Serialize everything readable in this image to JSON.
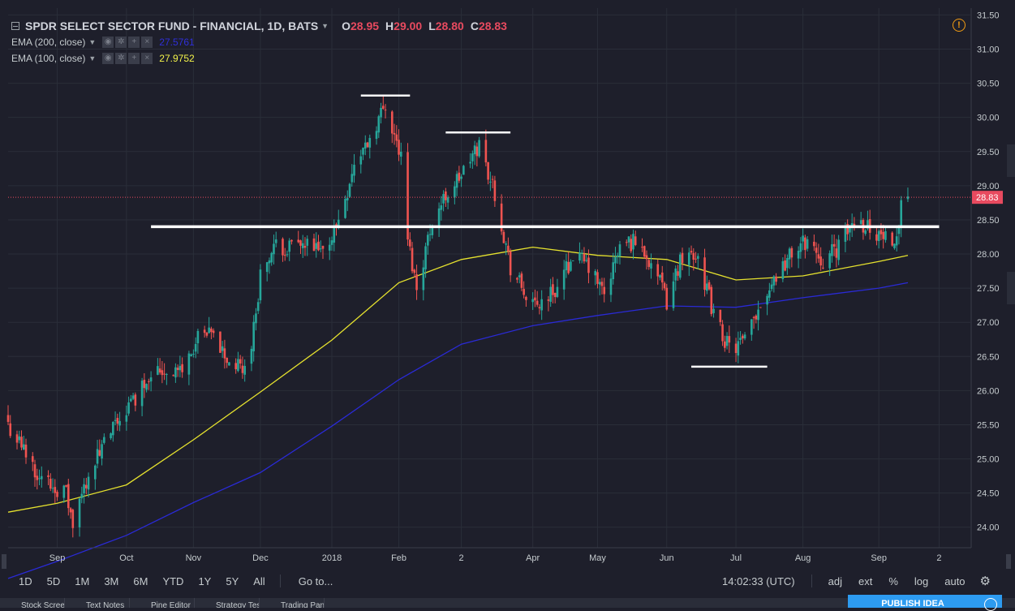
{
  "legend": {
    "title": "SPDR SELECT SECTOR FUND - FINANCIAL, 1D, BATS",
    "o_label": "O",
    "o_value": "28.95",
    "h_label": "H",
    "h_value": "29.00",
    "l_label": "L",
    "l_value": "28.80",
    "c_label": "C",
    "c_value": "28.83",
    "ema200_label": "EMA (200, close)",
    "ema200_value": "27.5761",
    "ema100_label": "EMA (100, close)",
    "ema100_value": "27.9752"
  },
  "toolbar": {
    "timeframes": [
      "1D",
      "5D",
      "1M",
      "3M",
      "6M",
      "YTD",
      "1Y",
      "5Y",
      "All"
    ],
    "goto": "Go to...",
    "time": "14:02:33 (UTC)",
    "adj": "adj",
    "ext": "ext",
    "pct": "%",
    "log": "log",
    "auto": "auto"
  },
  "footer": {
    "tabs": [
      "Stock Screener",
      "Text Notes",
      "Pine Editor",
      "Strategy Tester",
      "Trading Panel"
    ],
    "publish": "PUBLISH IDEA"
  },
  "colors": {
    "up": "#26a69a",
    "down": "#ef5350",
    "ema100": "#e6e22e",
    "ema200": "#2a2ad6",
    "last_price": "#e84a5f",
    "grid": "#2a2e39",
    "background": "#1e1f2b"
  },
  "chart_data": {
    "type": "candlestick",
    "title": "SPDR SELECT SECTOR FUND - FINANCIAL",
    "ylim": [
      23.7,
      31.6
    ],
    "y_ticks": [
      24.0,
      24.5,
      25.0,
      25.5,
      26.0,
      26.5,
      27.0,
      27.5,
      28.0,
      28.5,
      29.0,
      29.5,
      30.0,
      30.5,
      31.0,
      31.5
    ],
    "y_tick_labels": [
      "24.00",
      "24.50",
      "25.00",
      "25.50",
      "26.00",
      "26.50",
      "27.00",
      "27.50",
      "28.00",
      "28.50",
      "29.00",
      "29.50",
      "30.00",
      "30.50",
      "31.00",
      "31.50"
    ],
    "x_tick_labels": [
      "Sep",
      "Oct",
      "Nov",
      "Dec",
      "2018",
      "Feb",
      "2",
      "Apr",
      "May",
      "Jun",
      "Jul",
      "Aug",
      "Sep",
      "2"
    ],
    "x_ticks": [
      "2017-09-01",
      "2017-10-02",
      "2017-11-01",
      "2017-12-01",
      "2018-01-02",
      "2018-02-01",
      "2018-03-01",
      "2018-04-02",
      "2018-05-01",
      "2018-06-01",
      "2018-07-02",
      "2018-08-01",
      "2018-09-04",
      "2018-10-01"
    ],
    "x_range": [
      "2017-08-10",
      "2018-10-15"
    ],
    "last_price": 28.83,
    "last_price_label": "28.83",
    "anchors": [
      [
        "2017-08-10",
        25.5
      ],
      [
        "2017-08-25",
        24.7
      ],
      [
        "2017-09-05",
        24.5
      ],
      [
        "2017-09-08",
        24.0
      ],
      [
        "2017-09-15",
        24.8
      ],
      [
        "2017-09-29",
        25.6
      ],
      [
        "2017-10-06",
        25.9
      ],
      [
        "2017-10-13",
        26.3
      ],
      [
        "2017-10-27",
        26.3
      ],
      [
        "2017-11-03",
        26.75
      ],
      [
        "2017-11-10",
        26.8
      ],
      [
        "2017-11-17",
        26.4
      ],
      [
        "2017-11-24",
        26.3
      ],
      [
        "2017-11-28",
        26.9
      ],
      [
        "2017-12-01",
        27.7
      ],
      [
        "2017-12-08",
        28.1
      ],
      [
        "2017-12-15",
        28.1
      ],
      [
        "2017-12-22",
        28.1
      ],
      [
        "2017-12-29",
        28.0
      ],
      [
        "2018-01-05",
        28.5
      ],
      [
        "2018-01-12",
        29.3
      ],
      [
        "2018-01-19",
        29.7
      ],
      [
        "2018-01-26",
        30.2
      ],
      [
        "2018-02-02",
        29.4
      ],
      [
        "2018-02-05",
        28.2
      ],
      [
        "2018-02-09",
        27.5
      ],
      [
        "2018-02-16",
        28.5
      ],
      [
        "2018-02-23",
        28.9
      ],
      [
        "2018-03-02",
        29.2
      ],
      [
        "2018-03-09",
        29.6
      ],
      [
        "2018-03-16",
        28.9
      ],
      [
        "2018-03-23",
        27.8
      ],
      [
        "2018-04-02",
        27.2
      ],
      [
        "2018-04-13",
        27.5
      ],
      [
        "2018-04-20",
        28.0
      ],
      [
        "2018-04-27",
        27.8
      ],
      [
        "2018-05-04",
        27.4
      ],
      [
        "2018-05-11",
        28.1
      ],
      [
        "2018-05-18",
        28.2
      ],
      [
        "2018-05-25",
        27.9
      ],
      [
        "2018-06-01",
        27.3
      ],
      [
        "2018-06-08",
        28.0
      ],
      [
        "2018-06-15",
        28.0
      ],
      [
        "2018-06-22",
        27.1
      ],
      [
        "2018-06-29",
        26.6
      ],
      [
        "2018-07-06",
        26.7
      ],
      [
        "2018-07-13",
        27.3
      ],
      [
        "2018-07-20",
        27.7
      ],
      [
        "2018-07-27",
        28.0
      ],
      [
        "2018-08-03",
        28.2
      ],
      [
        "2018-08-10",
        27.9
      ],
      [
        "2018-08-17",
        28.1
      ],
      [
        "2018-08-24",
        28.5
      ],
      [
        "2018-08-31",
        28.4
      ],
      [
        "2018-09-07",
        28.2
      ],
      [
        "2018-09-12",
        28.3
      ],
      [
        "2018-09-14",
        28.8
      ],
      [
        "2018-09-17",
        28.85
      ]
    ],
    "ema100": [
      [
        "2017-08-10",
        24.22
      ],
      [
        "2017-09-01",
        24.35
      ],
      [
        "2017-10-02",
        24.62
      ],
      [
        "2017-11-01",
        25.28
      ],
      [
        "2017-12-01",
        25.98
      ],
      [
        "2018-01-02",
        26.74
      ],
      [
        "2018-02-01",
        27.58
      ],
      [
        "2018-03-01",
        27.92
      ],
      [
        "2018-04-02",
        28.1
      ],
      [
        "2018-05-01",
        27.98
      ],
      [
        "2018-06-01",
        27.92
      ],
      [
        "2018-07-02",
        27.62
      ],
      [
        "2018-08-01",
        27.68
      ],
      [
        "2018-09-04",
        27.89
      ],
      [
        "2018-09-17",
        27.98
      ]
    ],
    "ema200": [
      [
        "2017-08-10",
        23.25
      ],
      [
        "2017-09-01",
        23.5
      ],
      [
        "2017-10-02",
        23.88
      ],
      [
        "2017-11-01",
        24.36
      ],
      [
        "2017-12-01",
        24.8
      ],
      [
        "2018-01-02",
        25.48
      ],
      [
        "2018-02-01",
        26.16
      ],
      [
        "2018-03-01",
        26.68
      ],
      [
        "2018-04-02",
        26.95
      ],
      [
        "2018-05-01",
        27.1
      ],
      [
        "2018-06-01",
        27.24
      ],
      [
        "2018-07-02",
        27.22
      ],
      [
        "2018-08-01",
        27.36
      ],
      [
        "2018-09-04",
        27.5
      ],
      [
        "2018-09-17",
        27.58
      ]
    ],
    "annotations": [
      {
        "type": "hline",
        "y": 28.4,
        "x0": "2017-10-13",
        "x1": "2018-10-01"
      },
      {
        "type": "hline",
        "y": 30.32,
        "x0": "2018-01-15",
        "x1": "2018-02-06"
      },
      {
        "type": "hline",
        "y": 29.78,
        "x0": "2018-02-22",
        "x1": "2018-03-23"
      },
      {
        "type": "hline",
        "y": 26.35,
        "x0": "2018-06-12",
        "x1": "2018-07-16"
      }
    ]
  }
}
